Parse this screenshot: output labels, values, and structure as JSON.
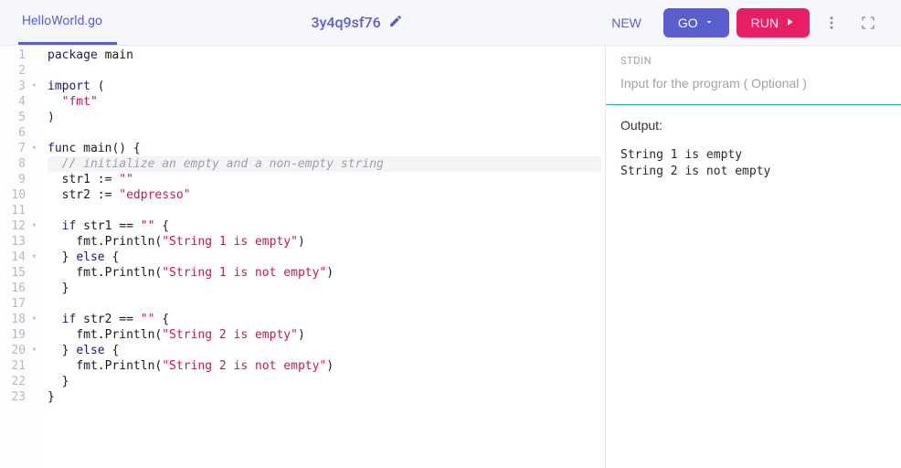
{
  "toolbar": {
    "filename": "HelloWorld.go",
    "page_id": "3y4q9sf76",
    "new_label": "NEW",
    "go_label": "GO",
    "run_label": "RUN"
  },
  "editor": {
    "lines": [
      {
        "n": 1,
        "fold": "",
        "segs": [
          {
            "t": "package",
            "c": "kw"
          },
          {
            "t": " main",
            "c": "ident"
          }
        ]
      },
      {
        "n": 2,
        "fold": "",
        "segs": []
      },
      {
        "n": 3,
        "fold": "▾",
        "segs": [
          {
            "t": "import",
            "c": "kw"
          },
          {
            "t": " (",
            "c": "ident"
          }
        ]
      },
      {
        "n": 4,
        "fold": "",
        "segs": [
          {
            "t": "  ",
            "c": "ident"
          },
          {
            "t": "\"fmt\"",
            "c": "str"
          }
        ]
      },
      {
        "n": 5,
        "fold": "",
        "segs": [
          {
            "t": ")",
            "c": "ident"
          }
        ]
      },
      {
        "n": 6,
        "fold": "",
        "segs": []
      },
      {
        "n": 7,
        "fold": "▾",
        "segs": [
          {
            "t": "func",
            "c": "kw"
          },
          {
            "t": " main() {",
            "c": "ident"
          }
        ]
      },
      {
        "n": 8,
        "fold": "",
        "hl": true,
        "segs": [
          {
            "t": "  ",
            "c": "ident"
          },
          {
            "t": "// initialize an empty and a non-empty string",
            "c": "cmt"
          }
        ]
      },
      {
        "n": 9,
        "fold": "",
        "segs": [
          {
            "t": "  str1 := ",
            "c": "ident"
          },
          {
            "t": "\"\"",
            "c": "str"
          }
        ]
      },
      {
        "n": 10,
        "fold": "",
        "segs": [
          {
            "t": "  str2 := ",
            "c": "ident"
          },
          {
            "t": "\"edpresso\"",
            "c": "str"
          }
        ]
      },
      {
        "n": 11,
        "fold": "",
        "segs": []
      },
      {
        "n": 12,
        "fold": "▾",
        "segs": [
          {
            "t": "  ",
            "c": "ident"
          },
          {
            "t": "if",
            "c": "kw"
          },
          {
            "t": " str1 == ",
            "c": "ident"
          },
          {
            "t": "\"\"",
            "c": "str"
          },
          {
            "t": " {",
            "c": "ident"
          }
        ]
      },
      {
        "n": 13,
        "fold": "",
        "segs": [
          {
            "t": "    fmt.Println(",
            "c": "ident"
          },
          {
            "t": "\"String 1 is empty\"",
            "c": "str"
          },
          {
            "t": ")",
            "c": "ident"
          }
        ]
      },
      {
        "n": 14,
        "fold": "▾",
        "segs": [
          {
            "t": "  } ",
            "c": "ident"
          },
          {
            "t": "else",
            "c": "kw"
          },
          {
            "t": " {",
            "c": "ident"
          }
        ]
      },
      {
        "n": 15,
        "fold": "",
        "segs": [
          {
            "t": "    fmt.Println(",
            "c": "ident"
          },
          {
            "t": "\"String 1 is not empty\"",
            "c": "str"
          },
          {
            "t": ")",
            "c": "ident"
          }
        ]
      },
      {
        "n": 16,
        "fold": "",
        "segs": [
          {
            "t": "  }",
            "c": "ident"
          }
        ]
      },
      {
        "n": 17,
        "fold": "",
        "segs": []
      },
      {
        "n": 18,
        "fold": "▾",
        "segs": [
          {
            "t": "  ",
            "c": "ident"
          },
          {
            "t": "if",
            "c": "kw"
          },
          {
            "t": " str2 == ",
            "c": "ident"
          },
          {
            "t": "\"\"",
            "c": "str"
          },
          {
            "t": " {",
            "c": "ident"
          }
        ]
      },
      {
        "n": 19,
        "fold": "",
        "segs": [
          {
            "t": "    fmt.Println(",
            "c": "ident"
          },
          {
            "t": "\"String 2 is empty\"",
            "c": "str"
          },
          {
            "t": ")",
            "c": "ident"
          }
        ]
      },
      {
        "n": 20,
        "fold": "▾",
        "segs": [
          {
            "t": "  } ",
            "c": "ident"
          },
          {
            "t": "else",
            "c": "kw"
          },
          {
            "t": " {",
            "c": "ident"
          }
        ]
      },
      {
        "n": 21,
        "fold": "",
        "segs": [
          {
            "t": "    fmt.Println(",
            "c": "ident"
          },
          {
            "t": "\"String 2 is not empty\"",
            "c": "str"
          },
          {
            "t": ")",
            "c": "ident"
          }
        ]
      },
      {
        "n": 22,
        "fold": "",
        "segs": [
          {
            "t": "  }",
            "c": "ident"
          }
        ]
      },
      {
        "n": 23,
        "fold": "",
        "segs": [
          {
            "t": "}",
            "c": "ident"
          }
        ]
      }
    ]
  },
  "side": {
    "stdin_label": "STDIN",
    "stdin_placeholder": "Input for the program ( Optional )",
    "stdin_value": "",
    "output_title": "Output:",
    "output_lines": [
      "String 1 is empty",
      "String 2 is not empty"
    ]
  }
}
